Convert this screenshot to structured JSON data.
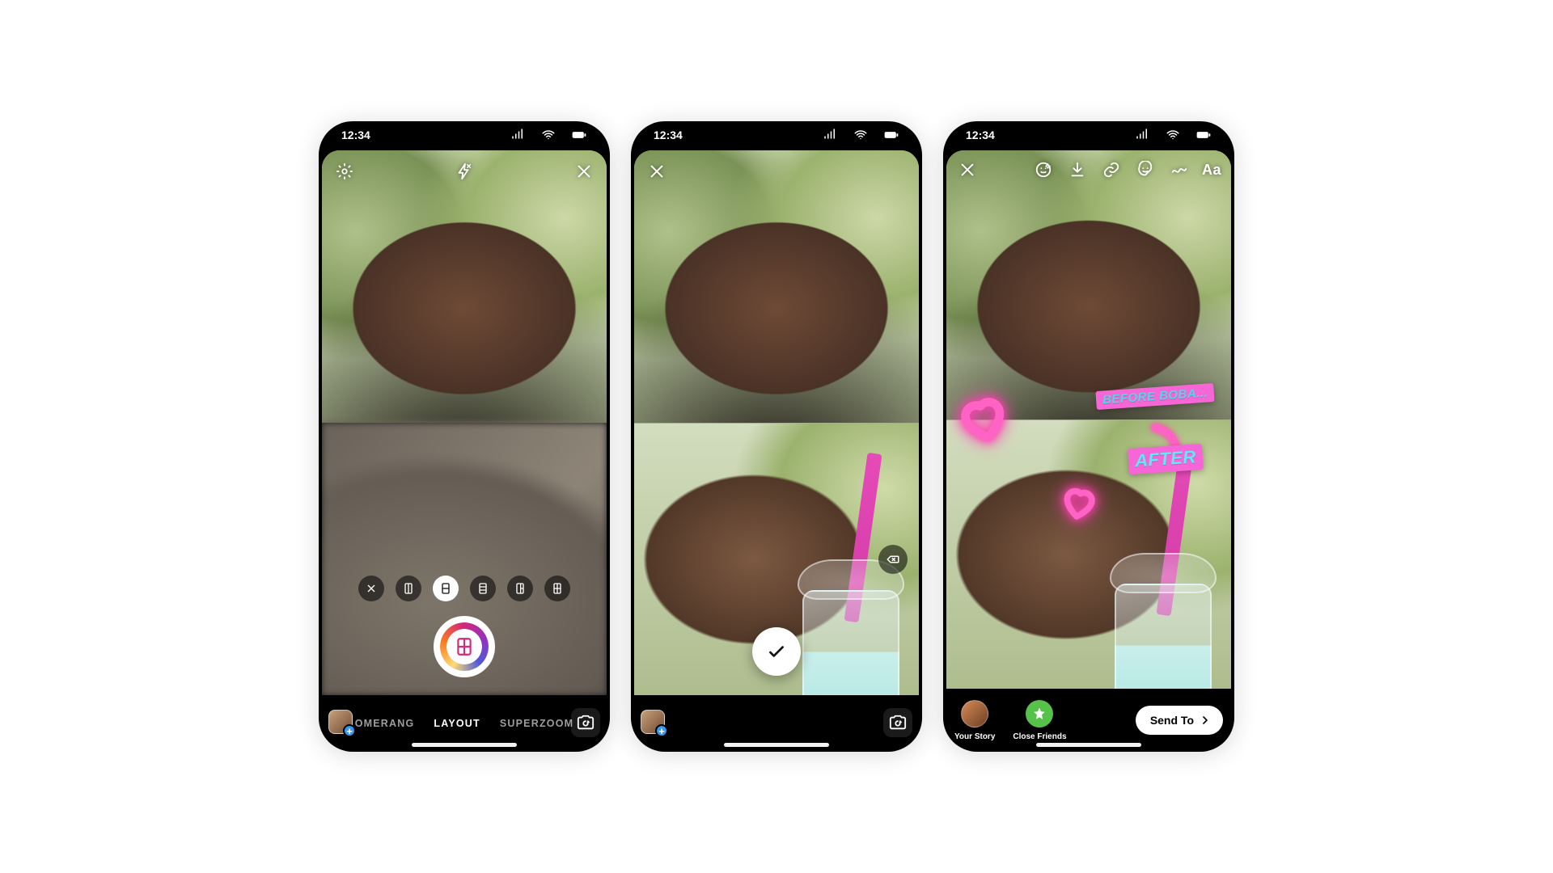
{
  "statusbar": {
    "time": "12:34"
  },
  "screen1": {
    "modes": {
      "prev": "OMERANG",
      "active": "LAYOUT",
      "next": "SUPERZOOM"
    },
    "icons": {
      "settings": "gear-icon",
      "flashOff": "flash-off-icon",
      "close": "close-icon",
      "optionsClose": "close-icon",
      "shutterLayout": "layout-icon",
      "gallery": "gallery-thumbnail",
      "flipCamera": "flip-camera-icon"
    },
    "layoutOptions": [
      "2-vert",
      "2-horiz-active",
      "3-vert",
      "2-col",
      "4-grid"
    ]
  },
  "screen2": {
    "icons": {
      "close": "close-icon",
      "deleteLast": "delete-backspace-icon",
      "confirm": "checkmark-icon",
      "gallery": "gallery-thumbnail",
      "flipCamera": "flip-camera-icon"
    }
  },
  "screen3": {
    "stickers": {
      "before": "BEFORE BOBA...",
      "after": "AFTER"
    },
    "editorTools": {
      "close": "close-icon",
      "faceFilter": "face-filter-icon",
      "save": "download-icon",
      "link": "link-icon",
      "stickerTray": "sticker-icon",
      "draw": "draw-squiggle-icon",
      "text": "Aa"
    },
    "share": {
      "yourStory": "Your Story",
      "closeFriends": "Close Friends",
      "sendTo": "Send To"
    }
  }
}
